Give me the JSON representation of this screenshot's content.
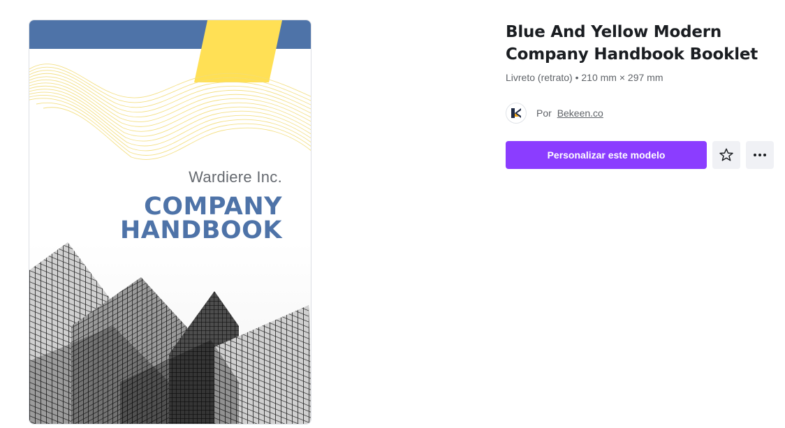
{
  "template": {
    "title": "Blue And Yellow Modern Company Handbook Booklet",
    "meta": "Livreto (retrato) • 210 mm × 297 mm",
    "author_prefix": "Por",
    "author_name": "Bekeen.co",
    "customize_label": "Personalizar este modelo",
    "favorite_icon": "star-outline-icon",
    "more_icon": "more-horizontal-icon"
  },
  "preview": {
    "company_name": "Wardiere Inc.",
    "headline_line1": "COMPANY",
    "headline_line2": "HANDBOOK",
    "colors": {
      "blue": "#4e73a8",
      "yellow": "#ffe055",
      "gray_text": "#666a70"
    }
  },
  "colors": {
    "accent": "#8b3dff",
    "icon_button_bg": "#f0f1f5",
    "title": "#1a1d21",
    "muted": "#5f6368"
  }
}
